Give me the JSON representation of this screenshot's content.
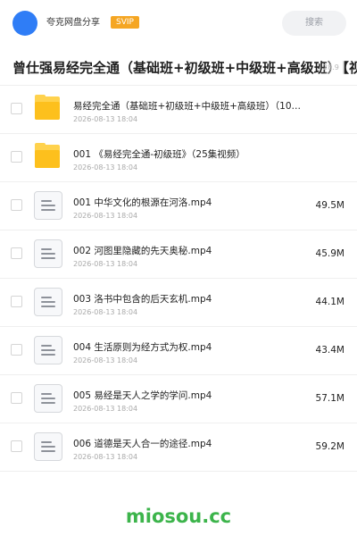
{
  "header": {
    "username": "夸克网盘分享",
    "badge": "SVIP",
    "search_placeholder": "搜索"
  },
  "share": {
    "title": "曾仕强易经完全通（基础班+初级班+中级班+高级班）【视",
    "title_size": "28.9",
    "title_tail": "【视"
  },
  "files": [
    {
      "type": "folder",
      "name": "易经完全通（基础班+初级班+中级班+高级班）（10…",
      "date": "2026-08-13 18:04",
      "size": ""
    },
    {
      "type": "folder",
      "name": "001 《易经完全通-初级班》（25集视频）",
      "date": "2026-08-13 18:04",
      "size": ""
    },
    {
      "type": "video",
      "name": "001 中华文化的根源在河洛.mp4",
      "date": "2026-08-13 18:04",
      "size": "49.5M"
    },
    {
      "type": "video",
      "name": "002 河图里隐藏的先天奥秘.mp4",
      "date": "2026-08-13 18:04",
      "size": "45.9M"
    },
    {
      "type": "video",
      "name": "003 洛书中包含的后天玄机.mp4",
      "date": "2026-08-13 18:04",
      "size": "44.1M"
    },
    {
      "type": "video",
      "name": "004 生活原则为经方式为权.mp4",
      "date": "2026-08-13 18:04",
      "size": "43.4M"
    },
    {
      "type": "video",
      "name": "005 易经是天人之学的学问.mp4",
      "date": "2026-08-13 18:04",
      "size": "57.1M"
    },
    {
      "type": "video",
      "name": "006 道德是天人合一的途径.mp4",
      "date": "2026-08-13 18:04",
      "size": "59.2M"
    }
  ],
  "watermark": "miosou.cc",
  "colors": {
    "avatar": "#2f7df6",
    "svip_badge": "#f5a623",
    "folder": "#fdc01d",
    "watermark": "#3cb44b"
  },
  "icons": {
    "folder": "folder-icon",
    "video": "file-document-icon"
  }
}
